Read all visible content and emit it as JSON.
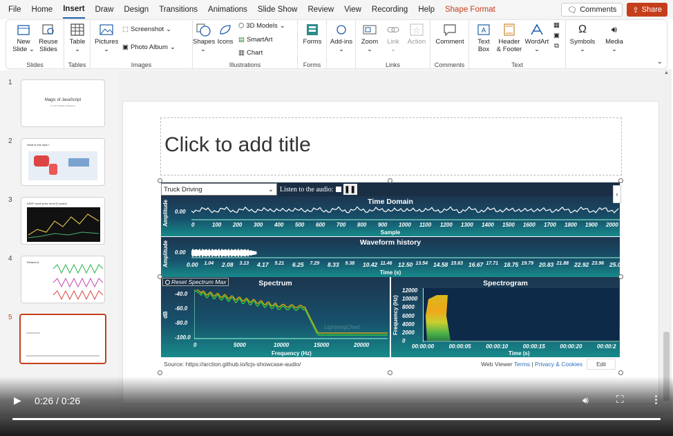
{
  "menu": {
    "items": [
      "File",
      "Home",
      "Insert",
      "Draw",
      "Design",
      "Transitions",
      "Animations",
      "Slide Show",
      "Review",
      "View",
      "Recording",
      "Help",
      "Shape Format"
    ],
    "active": "Insert",
    "comments_label": "Comments",
    "share_label": "Share"
  },
  "ribbon": {
    "slides": {
      "new_slide": "New Slide",
      "reuse_slides": "Reuse Slides",
      "group": "Slides"
    },
    "tables": {
      "table": "Table",
      "group": "Tables"
    },
    "images": {
      "pictures": "Pictures",
      "screenshot": "Screenshot",
      "photo_album": "Photo Album",
      "group": "Images"
    },
    "illustrations": {
      "shapes": "Shapes",
      "icons": "Icons",
      "models": "3D Models",
      "smartart": "SmartArt",
      "chart": "Chart",
      "group": "Illustrations"
    },
    "forms": {
      "forms": "Forms",
      "group": "Forms"
    },
    "addins": {
      "addins": "Add-ins"
    },
    "links": {
      "zoom": "Zoom",
      "link": "Link",
      "action": "Action",
      "group": "Links"
    },
    "comments": {
      "comment": "Comment",
      "group": "Comments"
    },
    "text": {
      "textbox": "Text Box",
      "header_footer": "Header & Footer",
      "wordart": "WordArt",
      "group": "Text"
    },
    "symbols": {
      "symbols": "Symbols"
    },
    "media": {
      "media": "Media"
    }
  },
  "thumbnails": [
    {
      "num": "1",
      "title": "Magic of JavaScript",
      "sub": "by Lisa Sullivan Hargraves"
    },
    {
      "num": "2",
      "title": "What is this topic?"
    },
    {
      "num": "3",
      "title": "ASEF stock price trend (5 years)"
    },
    {
      "num": "4",
      "title": "Related A"
    },
    {
      "num": "5",
      "title": ""
    }
  ],
  "selected_slide": "5",
  "slide": {
    "title_placeholder": "Click to add title"
  },
  "embed": {
    "dataset": "Truck Driving",
    "listen_label": "Listen to the audio:",
    "pause_label": "❚❚",
    "reset_label": "Reset Spectrum Max",
    "time_domain": {
      "title": "Time Domain",
      "y_label": "Amplitude",
      "y_tick": "0.00",
      "x_label": "Sample",
      "x_ticks": [
        "0",
        "100",
        "200",
        "300",
        "400",
        "500",
        "600",
        "700",
        "800",
        "900",
        "1000",
        "1100",
        "1200",
        "1300",
        "1400",
        "1500",
        "1600",
        "1700",
        "1800",
        "1900",
        "2000"
      ]
    },
    "waveform": {
      "title": "Waveform history",
      "y_label": "Amplitude",
      "y_tick": "0.00",
      "x_label": "Time (s)",
      "x_ticks": [
        "0.00",
        "1.04",
        "2.08",
        "3.13",
        "4.17",
        "5.21",
        "6.25",
        "7.29",
        "8.33",
        "9.38",
        "10.42",
        "11.46",
        "12.50",
        "13.54",
        "14.58",
        "15.63",
        "16.67",
        "17.71",
        "18.75",
        "19.79",
        "20.83",
        "21.88",
        "22.92",
        "23.96",
        "25.0"
      ]
    },
    "spectrum": {
      "title": "Spectrum",
      "y_label": "dB",
      "y_ticks": [
        "-40.0",
        "-60.0",
        "-80.0",
        "-100.0"
      ],
      "x_label": "Frequency (Hz)",
      "x_ticks": [
        "0",
        "5000",
        "10000",
        "15000",
        "20000"
      ]
    },
    "spectrogram": {
      "title": "Spectrogram",
      "y_label": "Frequency (Hz)",
      "y_ticks": [
        "12000",
        "10000",
        "8000",
        "6000",
        "4000",
        "2000",
        "0"
      ],
      "x_label": "Time (s)",
      "x_ticks": [
        "00:00:00",
        "00:00:05",
        "00:00:10",
        "00:00:15",
        "00:00:20",
        "00:00:2"
      ]
    },
    "watermark": "LightningChart",
    "footer": {
      "source": "Source: https://arction.github.io/lcjs-showcase-audio/",
      "web_viewer": "Web Viewer",
      "terms": "Terms",
      "sep": "|",
      "privacy": "Privacy & Cookies",
      "edit": "Edit"
    }
  },
  "video": {
    "time": "0:26 / 0:26",
    "progress": 1.0
  }
}
